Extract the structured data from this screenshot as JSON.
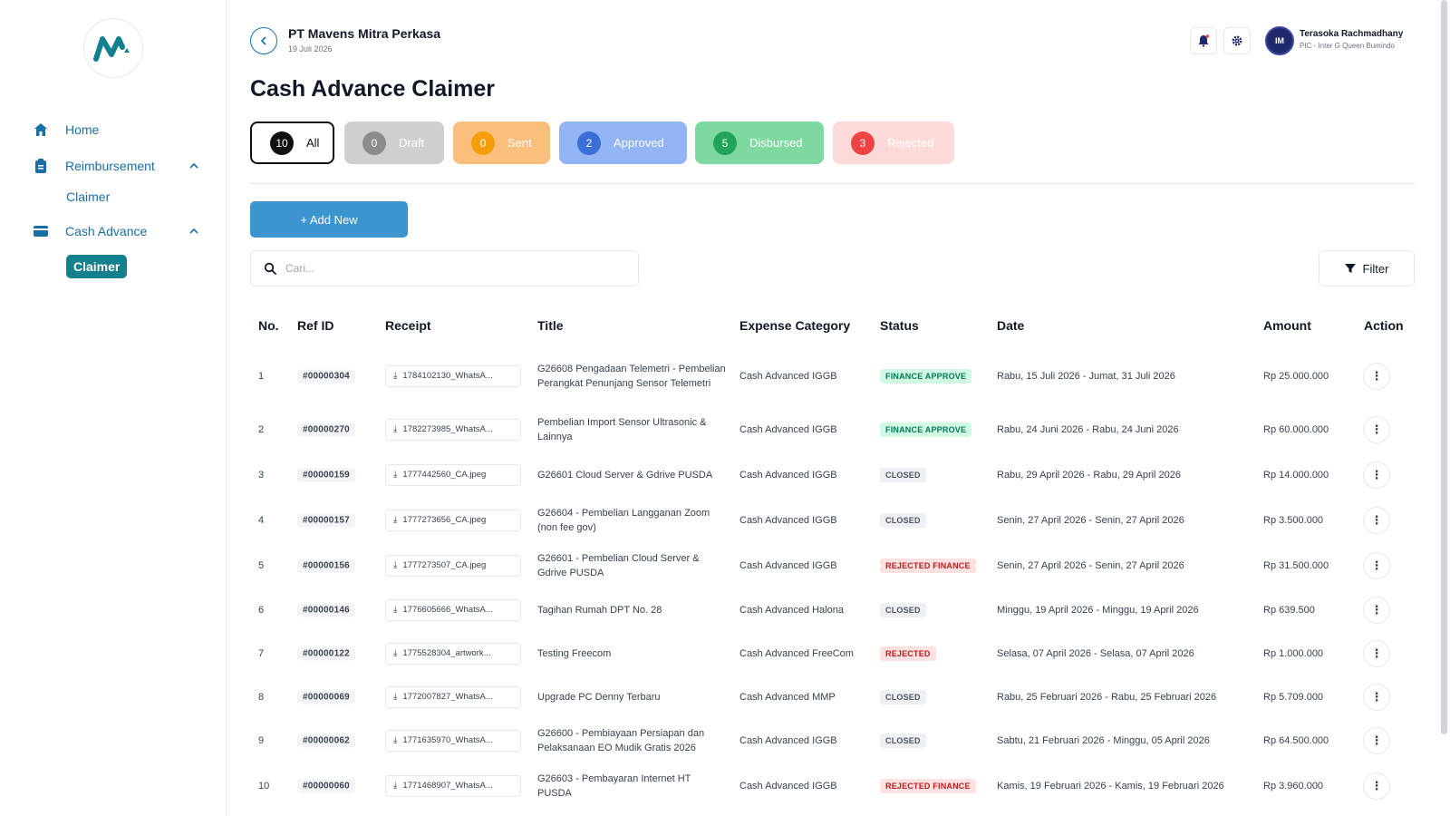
{
  "sidebar": {
    "items": [
      {
        "label": "Home",
        "icon": "home-icon"
      },
      {
        "label": "Reimbursement",
        "icon": "clipboard-icon",
        "sub": "Claimer"
      },
      {
        "label": "Cash Advance",
        "icon": "card-icon",
        "sub": "Claimer"
      }
    ]
  },
  "header": {
    "company": "PT Mavens Mitra Perkasa",
    "date": "19 Juli 2026",
    "user_name": "Terasoka Rachmadhany",
    "user_role": "PIC - Inter G Queen Bumindo",
    "avatar_text": "IM"
  },
  "page": {
    "title": "Cash Advance Claimer",
    "add_label": "+ Add New",
    "search_placeholder": "Cari...",
    "filter_label": "Filter"
  },
  "tabs": [
    {
      "count": "10",
      "label": "All",
      "bg": "#ffffff",
      "badge": "#111111"
    },
    {
      "count": "0",
      "label": "Draft",
      "bg": "#cfcfcf",
      "badge": "#8c8c8c"
    },
    {
      "count": "0",
      "label": "Sent",
      "bg": "#fbbf7d",
      "badge": "#f59e0b"
    },
    {
      "count": "2",
      "label": "Approved",
      "bg": "#93b4f5",
      "badge": "#3b6fd8"
    },
    {
      "count": "5",
      "label": "Disbursed",
      "bg": "#7ed9a0",
      "badge": "#22a55a"
    },
    {
      "count": "3",
      "label": "Rejected",
      "bg": "#fcdada",
      "badge": "#ef4444"
    }
  ],
  "table": {
    "headers": [
      "No.",
      "Ref ID",
      "Receipt",
      "Title",
      "Expense Category",
      "Status",
      "Date",
      "Amount",
      "Action"
    ],
    "rows": [
      {
        "no": "1",
        "ref": "#00000304",
        "receipt": "1784102130_WhatsA...",
        "title": "G26608 Pengadaan Telemetri - Pembelian Perangkat Penunjang Sensor Telemetri",
        "category": "Cash Advanced IGGB",
        "status": "FINANCE APPROVE",
        "status_type": "green",
        "date": "Rabu, 15 Juli 2026 - Jumat, 31 Juli 2026",
        "amount": "Rp 25.000.000"
      },
      {
        "no": "2",
        "ref": "#00000270",
        "receipt": "1782273985_WhatsA...",
        "title": "Pembelian Import Sensor Ultrasonic & Lainnya",
        "category": "Cash Advanced IGGB",
        "status": "FINANCE APPROVE",
        "status_type": "green",
        "date": "Rabu, 24 Juni 2026 - Rabu, 24 Juni 2026",
        "amount": "Rp 60.000.000"
      },
      {
        "no": "3",
        "ref": "#00000159",
        "receipt": "1777442560_CA.jpeg",
        "title": "G26601 Cloud Server & Gdrive PUSDA",
        "category": "Cash Advanced IGGB",
        "status": "CLOSED",
        "status_type": "gray",
        "date": "Rabu, 29 April 2026 - Rabu, 29 April 2026",
        "amount": "Rp 14.000.000"
      },
      {
        "no": "4",
        "ref": "#00000157",
        "receipt": "1777273656_CA.jpeg",
        "title": "G26604 - Pembelian Langganan Zoom (non fee gov)",
        "category": "Cash Advanced IGGB",
        "status": "CLOSED",
        "status_type": "gray",
        "date": "Senin, 27 April 2026 - Senin, 27 April 2026",
        "amount": "Rp 3.500.000"
      },
      {
        "no": "5",
        "ref": "#00000156",
        "receipt": "1777273507_CA.jpeg",
        "title": "G26601 - Pembelian Cloud Server & Gdrive PUSDA",
        "category": "Cash Advanced IGGB",
        "status": "REJECTED FINANCE",
        "status_type": "red",
        "date": "Senin, 27 April 2026 - Senin, 27 April 2026",
        "amount": "Rp 31.500.000"
      },
      {
        "no": "6",
        "ref": "#00000146",
        "receipt": "1776605666_WhatsA...",
        "title": "Tagihan Rumah DPT No. 28",
        "category": "Cash Advanced Halona",
        "status": "CLOSED",
        "status_type": "gray",
        "date": "Minggu, 19 April 2026 - Minggu, 19 April 2026",
        "amount": "Rp 639.500"
      },
      {
        "no": "7",
        "ref": "#00000122",
        "receipt": "1775528304_artwork...",
        "title": "Testing Freecom",
        "category": "Cash Advanced FreeCom",
        "status": "REJECTED",
        "status_type": "red",
        "date": "Selasa, 07 April 2026 - Selasa, 07 April 2026",
        "amount": "Rp 1.000.000"
      },
      {
        "no": "8",
        "ref": "#00000069",
        "receipt": "1772007827_WhatsA...",
        "title": "Upgrade PC Denny Terbaru",
        "category": "Cash Advanced MMP",
        "status": "CLOSED",
        "status_type": "gray",
        "date": "Rabu, 25 Februari 2026 - Rabu, 25 Februari 2026",
        "amount": "Rp 5.709.000"
      },
      {
        "no": "9",
        "ref": "#00000062",
        "receipt": "1771635970_WhatsA...",
        "title": "G26600 - Pembiayaan Persiapan dan Pelaksanaan EO Mudik Gratis 2026",
        "category": "Cash Advanced IGGB",
        "status": "CLOSED",
        "status_type": "gray",
        "date": "Sabtu, 21 Februari 2026 - Minggu, 05 April 2026",
        "amount": "Rp 64.500.000"
      },
      {
        "no": "10",
        "ref": "#00000060",
        "receipt": "1771468907_WhatsA...",
        "title": "G26603 - Pembayaran Internet HT PUSDA",
        "category": "Cash Advanced IGGB",
        "status": "REJECTED FINANCE",
        "status_type": "red",
        "date": "Kamis, 19 Februari 2026 - Kamis, 19 Februari 2026",
        "amount": "Rp 3.960.000"
      }
    ]
  }
}
